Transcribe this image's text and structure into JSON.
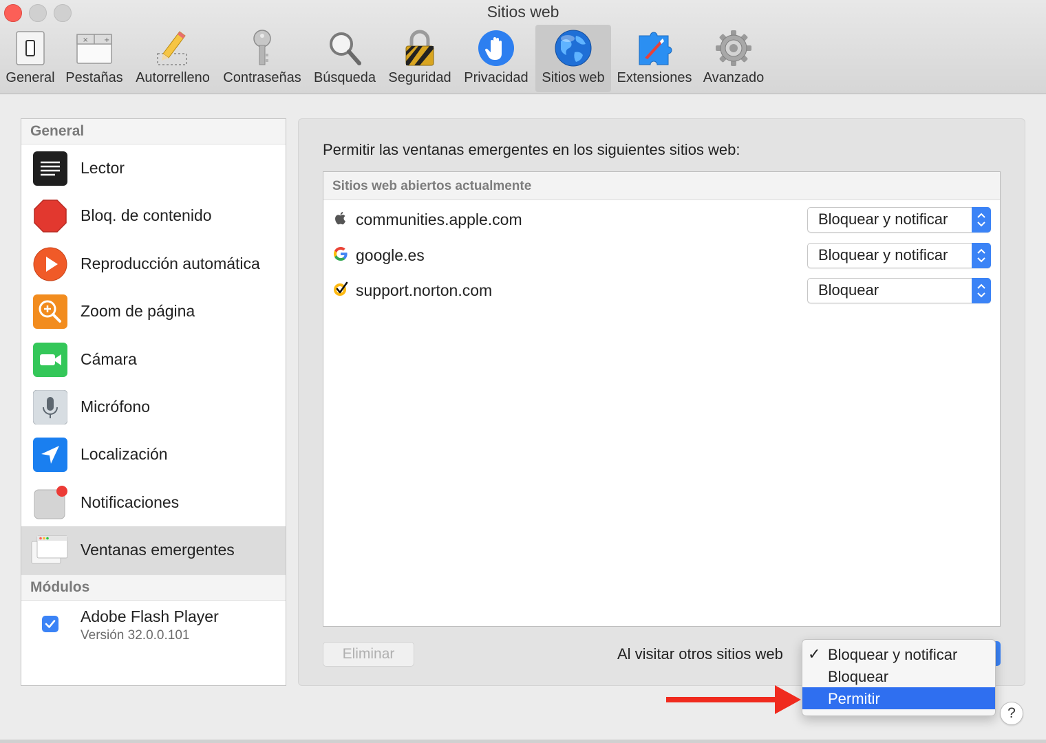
{
  "window": {
    "title": "Sitios web"
  },
  "toolbar": {
    "items": [
      {
        "label": "General",
        "icon": "general-switch-icon"
      },
      {
        "label": "Pestañas",
        "icon": "tabs-icon"
      },
      {
        "label": "Autorrelleno",
        "icon": "pencil-icon"
      },
      {
        "label": "Contraseñas",
        "icon": "key-icon"
      },
      {
        "label": "Búsqueda",
        "icon": "magnifier-icon"
      },
      {
        "label": "Seguridad",
        "icon": "padlock-icon"
      },
      {
        "label": "Privacidad",
        "icon": "hand-icon"
      },
      {
        "label": "Sitios web",
        "icon": "globe-icon",
        "selected": true
      },
      {
        "label": "Extensiones",
        "icon": "puzzle-icon"
      },
      {
        "label": "Avanzado",
        "icon": "gear-icon"
      }
    ]
  },
  "sidebar": {
    "general_header": "General",
    "items": [
      {
        "label": "Lector",
        "icon": "reader-icon"
      },
      {
        "label": "Bloq. de contenido",
        "icon": "stop-sign-icon"
      },
      {
        "label": "Reproducción automática",
        "icon": "play-icon"
      },
      {
        "label": "Zoom de página",
        "icon": "zoom-icon"
      },
      {
        "label": "Cámara",
        "icon": "camera-icon"
      },
      {
        "label": "Micrófono",
        "icon": "microphone-icon"
      },
      {
        "label": "Localización",
        "icon": "location-arrow-icon"
      },
      {
        "label": "Notificaciones",
        "icon": "notification-icon"
      },
      {
        "label": "Ventanas emergentes",
        "icon": "popup-window-icon",
        "selected": true
      }
    ],
    "modules_header": "Módulos",
    "modules": [
      {
        "name": "Adobe Flash Player",
        "version": "Versión 32.0.0.101",
        "checked": true
      }
    ]
  },
  "main": {
    "heading": "Permitir las ventanas emergentes en los siguientes sitios web:",
    "table_header": "Sitios web abiertos actualmente",
    "sites": [
      {
        "domain": "communities.apple.com",
        "setting": "Bloquear y notificar",
        "favicon": "apple-logo-icon"
      },
      {
        "domain": "google.es",
        "setting": "Bloquear y notificar",
        "favicon": "google-logo-icon"
      },
      {
        "domain": "support.norton.com",
        "setting": "Bloquear",
        "favicon": "norton-check-icon"
      }
    ],
    "remove_button": "Eliminar",
    "other_sites_label": "Al visitar otros sitios web"
  },
  "dropdown": {
    "options": [
      {
        "label": "Bloquear y notificar",
        "checked": true
      },
      {
        "label": "Bloquear"
      },
      {
        "label": "Permitir",
        "highlighted": true
      }
    ]
  },
  "help": {
    "label": "?"
  },
  "colors": {
    "accent": "#3b83f6",
    "highlight": "#2f6ff0",
    "arrow": "#f02a1e",
    "close": "#fc5f57"
  }
}
